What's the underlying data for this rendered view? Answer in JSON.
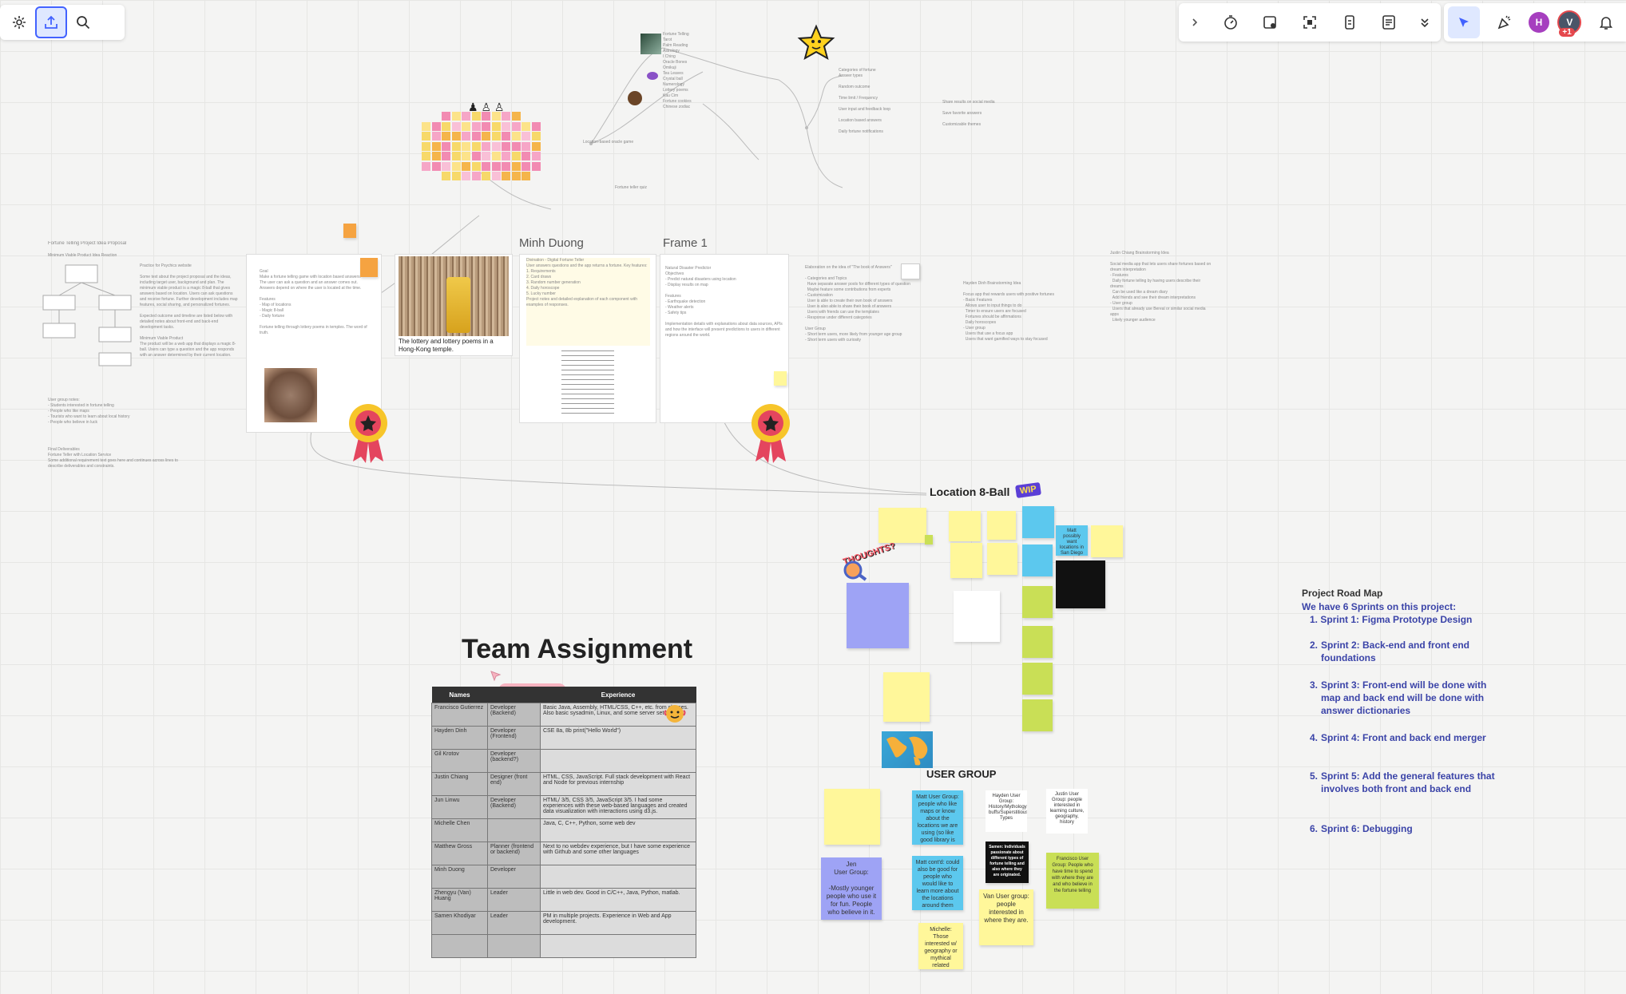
{
  "toolbar_left": {
    "icons": [
      "settings-icon",
      "upload-icon",
      "search-icon"
    ]
  },
  "toolbar_right": {
    "icons": [
      "chevron-right-icon",
      "timer-icon",
      "screen-share-icon",
      "focus-icon",
      "card-icon",
      "notes-icon",
      "chevron-down-icon"
    ],
    "tools": [
      "select-arrow-icon",
      "reaction-icon"
    ],
    "users": [
      {
        "initial": "H",
        "color": "#a63fbf"
      },
      {
        "initial": "V",
        "color": "#4a5568"
      }
    ],
    "user_count": "+1",
    "bell": "bell-icon"
  },
  "frames": {
    "minh_label": "Minh Duong",
    "frame1_label": "Frame 1"
  },
  "lottery_caption": "The lottery and lottery poems in a Hong-Kong temple.",
  "location": {
    "title": "Location 8-Ball",
    "wip": "WIP"
  },
  "thoughts": "THOUGHTS?",
  "user_group": {
    "title": "USER GROUP"
  },
  "stickies": {
    "matt": "Matt possibly want locations in San Diego or California!",
    "user_bottom_1": "Matt User Group: people who like maps or know about the locations we are using (so like good library is good for social students)",
    "user_bottom_2": "Matt cont'd: could also be good for people who would like to learn more about the locations around them",
    "vanuser": "Van User group: people interested in where they are.",
    "michelle": "Michelle: Those interested w/ geography or mythical related location's history",
    "jen": "Jen\nUser Group:\n\n-Mostly younger people who use it for fun. People who believe in it.",
    "francisco": "Francisco User Group:\nPeople who have time to spend with where they are and who believe in the fortune telling",
    "justin": "Justin User Group:\npeople interested in learning culture, geography, history",
    "hayden": "Hayden User Group: History/Mythology buffs/Superstitious Types",
    "samen": "Samen: Individuals passionate about different types of fortune telling and also where they are originated."
  },
  "team": {
    "title": "Team Assignment",
    "cursor_name": "Hayden Dinh",
    "headers": [
      "Names",
      "",
      "Experience"
    ],
    "rows": [
      [
        "Francisco Gutierrez",
        "Developer (Backend)",
        "Basic Java, Assembly, HTML/CSS, C++, etc. from classes. Also basic sysadmin, Linux, and some server setups."
      ],
      [
        "Hayden Dinh",
        "Developer (Frontend)",
        "CSE 8a, 8b print(\"Hello World\")"
      ],
      [
        "Gil Krotov",
        "Developer (backend?)",
        ""
      ],
      [
        "Justin Chiang",
        "Designer (front end)",
        "HTML, CSS, JavaScript. Full stack development with React and Node for previous internship"
      ],
      [
        "Jun Linwu",
        "Developer (Backend)",
        "HTML/ 3/5, CSS 3/5, JavaScript 3/5. I had some experiences with these web-based languages and created data visualization with interactions using d3.js."
      ],
      [
        "Michelle Chen",
        "",
        "Java, C, C++, Python, some web dev"
      ],
      [
        "Matthew Gross",
        "Planner (frontend or backend)",
        "Next to no webdev experience, but I have some experience with Github and some other languages"
      ],
      [
        "Minh Duong",
        "Developer",
        ""
      ],
      [
        "Zhengyu (Van) Huang",
        "Leader",
        "Little in web dev. Good in C/C++, Java, Python, matlab."
      ],
      [
        "Samen Khodiyar",
        "Leader",
        "PM in multiple projects. Experience in Web and App development."
      ],
      [
        "",
        "",
        ""
      ]
    ]
  },
  "roadmap": {
    "heading": "Project Road Map",
    "intro": "We have 6 Sprints on this project:",
    "items": [
      "Sprint 1: Figma Prototype Design",
      "Sprint 2: Back-end and front end foundations",
      "Sprint 3: Front-end will be done with map and back end will be done with answer dictionaries",
      "Sprint 4: Front and back end merger",
      "Sprint 5: Add the general features that involves both front and back end",
      "Sprint 6: Debugging"
    ],
    "numbers": [
      "1.",
      "2.",
      "3.",
      "4.",
      "5.",
      "6."
    ]
  },
  "colors": {
    "accent": "#4262ff",
    "roadmap_text": "#3b44a8",
    "sticky_blue": "#5cc8ee",
    "sticky_yellow": "#fff79a",
    "sticky_lime": "#c9df56",
    "sticky_purple": "#9ea3f5"
  }
}
